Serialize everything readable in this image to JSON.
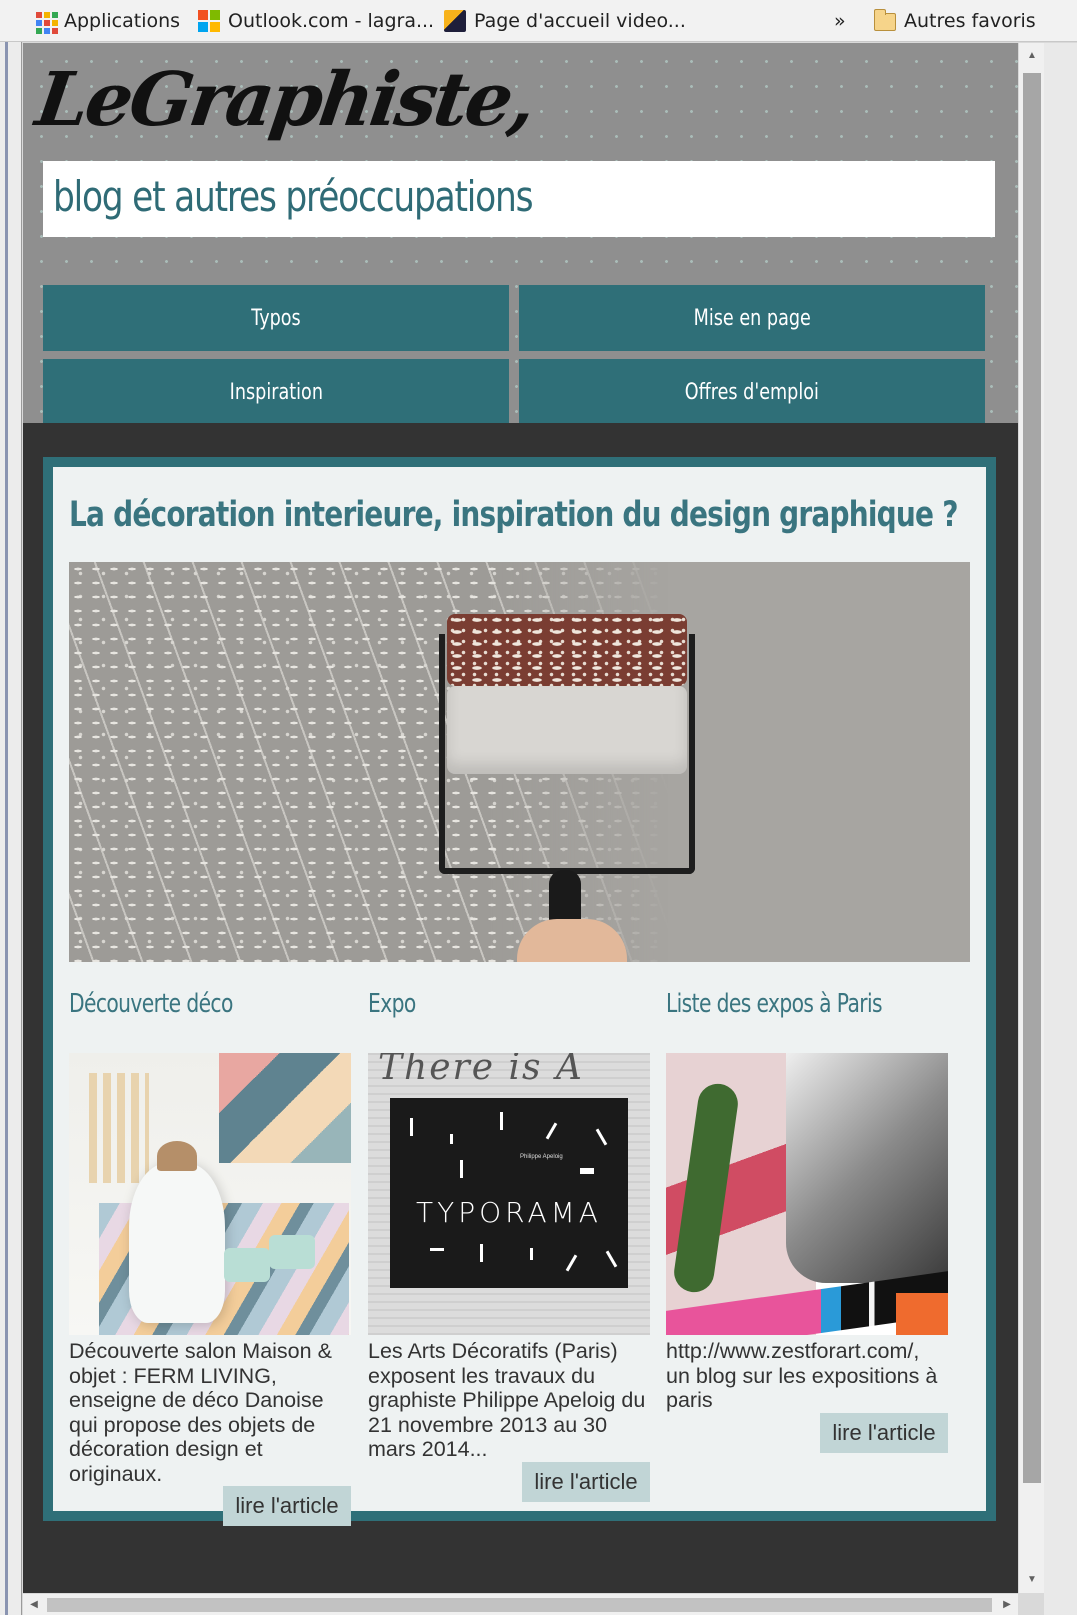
{
  "bookmarks": {
    "items": [
      {
        "label": "Applications",
        "icon": "apps-grid-icon"
      },
      {
        "label": "Outlook.com - lagra...",
        "icon": "microsoft-icon"
      },
      {
        "label": "Page d'accueil video...",
        "icon": "video-icon"
      }
    ],
    "overflow": "»",
    "other_label": "Autres favoris"
  },
  "site": {
    "logo": "LeGraphiste,",
    "tagline": "blog et autres préoccupations"
  },
  "nav": {
    "items": [
      "Typos",
      "Mise en page",
      "Inspiration",
      "Offres d'emploi"
    ]
  },
  "featured": {
    "title": "La décoration interieure, inspiration du design graphique ?"
  },
  "articles": [
    {
      "title": "Découverte déco",
      "text": "Découverte salon Maison & objet : FERM LIVING, enseigne de déco Danoise qui propose des objets de décoration design et originaux.",
      "read_more": "lire l'article"
    },
    {
      "title": "Expo",
      "text": "Les Arts Décoratifs (Paris) exposent les travaux du graphiste Philippe Apeloig du 21 novembre 2013 au 30 mars 2014...",
      "read_more": "lire l'article",
      "image_text": "TYPORAMA",
      "image_author": "Philippe Apeloig",
      "image_script": "There is A"
    },
    {
      "title": "Liste des expos à Paris",
      "text": "http://www.zestforart.com/, un blog sur les expositions à paris",
      "read_more": "lire l'article"
    }
  ],
  "colors": {
    "accent": "#2f6f78",
    "heading": "#3a7580",
    "button_bg": "#c1d5d6"
  }
}
